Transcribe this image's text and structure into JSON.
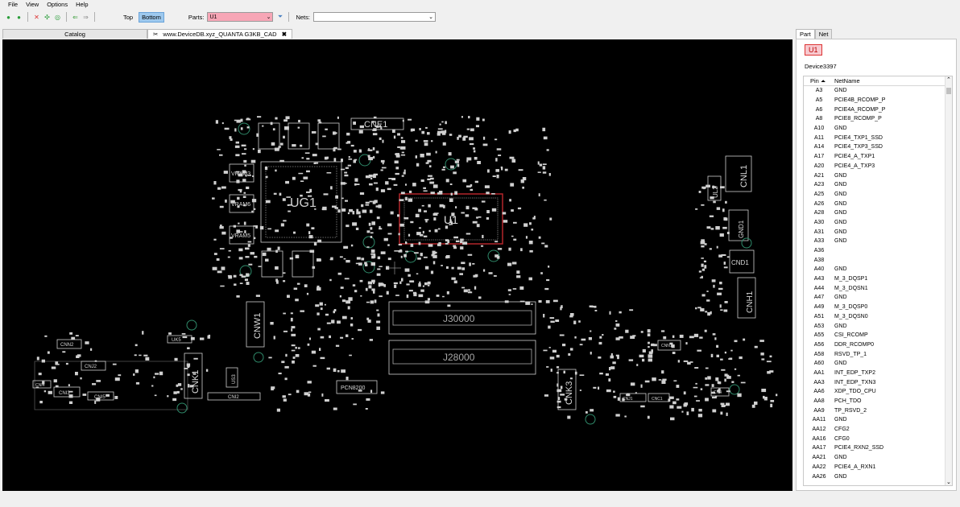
{
  "menu": [
    "File",
    "View",
    "Options",
    "Help"
  ],
  "toolbar": {
    "top_label": "Top",
    "bottom_label": "Bottom",
    "parts_label": "Parts:",
    "parts_value": "U1",
    "nets_label": "Nets:",
    "nets_value": ""
  },
  "tabs": [
    {
      "label": "Catalog"
    },
    {
      "label": "www.DeviceDB.xyz_QUANTA G3KB_CAD"
    }
  ],
  "board": {
    "labels": [
      "UG1",
      "U1",
      "CNE1",
      "J30000",
      "J28000",
      "VRAM3",
      "VRAM6",
      "VRAM5",
      "CNW1",
      "CNK1",
      "CNK3",
      "CNL1",
      "UL2",
      "CNH1",
      "GND1",
      "CND1",
      "CNN2",
      "CNJ2",
      "CNI3",
      "CNI5",
      "CNI2",
      "CNI4",
      "PCN8200",
      "US3",
      "UK5",
      "CNN1",
      "CNJ1",
      "CNC1",
      "CN4"
    ]
  },
  "right_panel": {
    "tabs": [
      "Part",
      "Net"
    ],
    "part": "U1",
    "device": "Device3397",
    "col_pin": "Pin",
    "col_net": "NetName",
    "rows": [
      [
        "A3",
        "GND"
      ],
      [
        "A5",
        "PCIE4B_RCOMP_P"
      ],
      [
        "A6",
        "PCIE4A_RCOMP_P"
      ],
      [
        "A8",
        "PCIE8_RCOMP_P"
      ],
      [
        "A10",
        "GND"
      ],
      [
        "A11",
        "PCIE4_TXP1_SSD"
      ],
      [
        "A14",
        "PCIE4_TXP3_SSD"
      ],
      [
        "A17",
        "PCIE4_A_TXP1"
      ],
      [
        "A20",
        "PCIE4_A_TXP3"
      ],
      [
        "A21",
        "GND"
      ],
      [
        "A23",
        "GND"
      ],
      [
        "A25",
        "GND"
      ],
      [
        "A26",
        "GND"
      ],
      [
        "A28",
        "GND"
      ],
      [
        "A30",
        "GND"
      ],
      [
        "A31",
        "GND"
      ],
      [
        "A33",
        "GND"
      ],
      [
        "A36",
        ""
      ],
      [
        "A38",
        ""
      ],
      [
        "A40",
        "GND"
      ],
      [
        "A43",
        "M_3_DQSP1"
      ],
      [
        "A44",
        "M_3_DQSN1"
      ],
      [
        "A47",
        "GND"
      ],
      [
        "A49",
        "M_3_DQSP0"
      ],
      [
        "A51",
        "M_3_DQSN0"
      ],
      [
        "A53",
        "GND"
      ],
      [
        "A55",
        "CSI_RCOMP"
      ],
      [
        "A56",
        "DDR_RCOMP0"
      ],
      [
        "A58",
        "RSVD_TP_1"
      ],
      [
        "A60",
        "GND"
      ],
      [
        "AA1",
        "INT_EDP_TXP2"
      ],
      [
        "AA3",
        "INT_EDP_TXN3"
      ],
      [
        "AA6",
        "XDP_TDO_CPU"
      ],
      [
        "AA8",
        "PCH_TDO"
      ],
      [
        "AA9",
        "TP_RSVD_2"
      ],
      [
        "AA11",
        "GND"
      ],
      [
        "AA12",
        "CFG2"
      ],
      [
        "AA16",
        "CFG0"
      ],
      [
        "AA17",
        "PCIE4_RXN2_SSD"
      ],
      [
        "AA21",
        "GND"
      ],
      [
        "AA22",
        "PCIE4_A_RXN1"
      ],
      [
        "AA26",
        "GND"
      ]
    ]
  },
  "colors": {
    "selected_part": "#c0282d",
    "trace": "#d9d9d9",
    "bg": "#000000"
  }
}
